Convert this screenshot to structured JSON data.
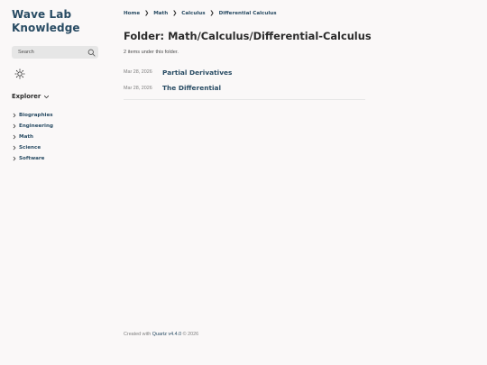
{
  "sidebar": {
    "site_title_line1": "Wave Lab",
    "site_title_line2": "Knowledge",
    "search_placeholder": "Search",
    "search_icon": "search-icon",
    "theme_icon": "sun-icon",
    "explorer_title": "Explorer",
    "explorer_items": [
      {
        "label": "Biographies"
      },
      {
        "label": "Engineering"
      },
      {
        "label": "Math"
      },
      {
        "label": "Science"
      },
      {
        "label": "Software"
      }
    ]
  },
  "breadcrumb": {
    "items": [
      "Home",
      "Math",
      "Calculus",
      "Differential Calculus"
    ],
    "separator": "❯"
  },
  "main": {
    "title": "Folder: Math/Calculus/Differential-Calculus",
    "item_count": "2 items under this folder.",
    "posts": [
      {
        "date": "Mar 28, 2026",
        "title": "Partial Derivatives"
      },
      {
        "date": "Mar 28, 2026",
        "title": "The Differential"
      }
    ]
  },
  "footer": {
    "prefix": "Created with ",
    "link": "Quartz v4.4.0",
    "suffix": " © 2026"
  },
  "colors": {
    "background": "#faf8f8",
    "accent": "#284b63",
    "text": "#2b2b2b",
    "muted": "#7f7f7f",
    "search_bg": "#e6e6e6"
  }
}
